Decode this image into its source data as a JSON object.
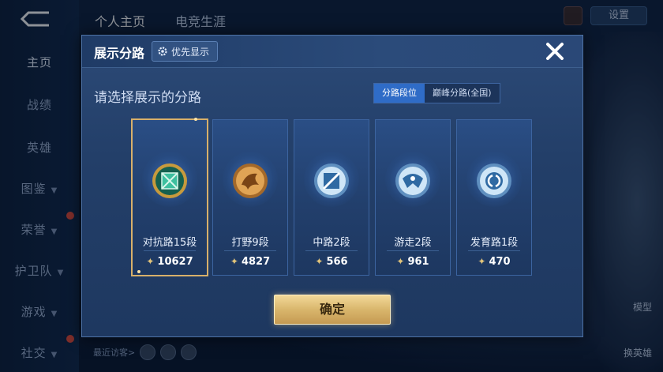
{
  "background": {
    "top_tabs": [
      "个人主页",
      "电竞生涯"
    ],
    "sidebar": [
      {
        "label": "主页",
        "active": true
      },
      {
        "label": "战绩"
      },
      {
        "label": "英雄"
      },
      {
        "label": "图鉴"
      },
      {
        "label": "荣誉"
      },
      {
        "label": "护卫队"
      },
      {
        "label": "游戏"
      },
      {
        "label": "社交"
      }
    ],
    "settings_label": "设置",
    "model_label": "模型",
    "swap_hero_label": "换英雄",
    "recent_visitors_label": "最近访客>"
  },
  "modal": {
    "title": "展示分路",
    "priority_label": "优先显示",
    "prompt": "请选择展示的分路",
    "toggle": [
      {
        "label": "分路段位",
        "active": true
      },
      {
        "label": "巅峰分路(全国)",
        "active": false
      }
    ],
    "cards": [
      {
        "name": "对抗路15段",
        "score": "10627",
        "selected": true,
        "badge_color": "#3dbf9f"
      },
      {
        "name": "打野9段",
        "score": "4827",
        "selected": false,
        "badge_color": "#c9893f"
      },
      {
        "name": "中路2段",
        "score": "566",
        "selected": false,
        "badge_color": "#8cc0e8"
      },
      {
        "name": "游走2段",
        "score": "961",
        "selected": false,
        "badge_color": "#8cc0e8"
      },
      {
        "name": "发育路1段",
        "score": "470",
        "selected": false,
        "badge_color": "#8cc0e8"
      }
    ],
    "confirm_label": "确定"
  },
  "colors": {
    "accent_gold": "#d8b06a",
    "toggle_active": "#2f6cc7",
    "modal_bg": "#233f69"
  }
}
